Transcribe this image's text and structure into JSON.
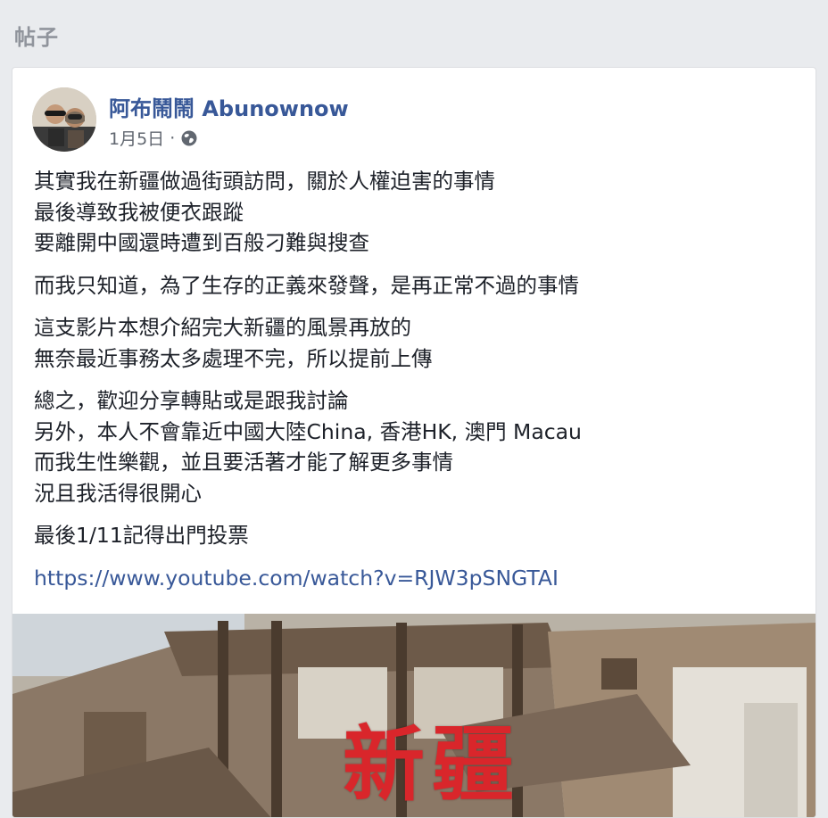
{
  "page": {
    "section_title": "帖子"
  },
  "post": {
    "author": "阿布鬧鬧 Abunownow",
    "date": "1月5日",
    "separator": "·",
    "visibility_icon": "globe-icon",
    "paragraphs": [
      {
        "lines": [
          "其實我在新疆做過街頭訪問，關於人權迫害的事情",
          "最後導致我被便衣跟蹤",
          "要離開中國還時遭到百般刁難與搜查"
        ]
      },
      {
        "lines": [
          "而我只知道，為了生存的正義來發聲，是再正常不過的事情"
        ]
      },
      {
        "lines": [
          "這支影片本想介紹完大新疆的風景再放的",
          "無奈最近事務太多處理不完，所以提前上傳"
        ]
      },
      {
        "lines": [
          "總之，歡迎分享轉貼或是跟我討論",
          "另外，本人不會靠近中國大陸China, 香港HK, 澳門 Macau",
          "而我生性樂觀，並且要活著才能了解更多事情",
          "況且我活得很開心"
        ]
      },
      {
        "lines": [
          "最後1/11記得出門投票"
        ]
      }
    ],
    "link": "https://www.youtube.com/watch?v=RJW3pSNGTAI",
    "thumbnail_title": "新疆"
  },
  "colors": {
    "background": "#e9ebee",
    "card": "#ffffff",
    "author_link": "#385898",
    "meta_text": "#616770",
    "thumbnail_text": "#d9262b"
  }
}
